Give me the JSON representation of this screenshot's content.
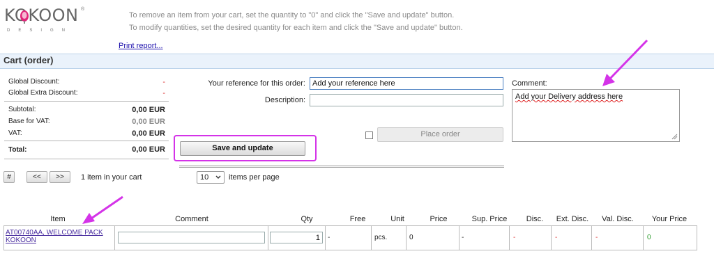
{
  "header": {
    "logo_text": "KOKOON",
    "logo_subtext": "DESIGN",
    "logo_mark": "®",
    "instructions": [
      "To remove an item from your cart, set the quantity to \"0\" and click the \"Save and update\" button.",
      "To modify quantities, set the desired quantity for each item and click the \"Save and update\" button."
    ],
    "print_report": "Print report..."
  },
  "section": {
    "title": "Cart (order)"
  },
  "totals": {
    "global_discount_label": "Global Discount:",
    "global_discount_value": "-",
    "global_extra_discount_label": "Global Extra Discount:",
    "global_extra_discount_value": "-",
    "subtotal_label": "Subtotal:",
    "subtotal_value": "0,00 EUR",
    "base_vat_label": "Base for VAT:",
    "base_vat_value": "0,00 EUR",
    "vat_label": "VAT:",
    "vat_value": "0,00 EUR",
    "total_label": "Total:",
    "total_value": "0,00 EUR"
  },
  "form": {
    "reference_label": "Your reference for this order:",
    "reference_value": "Add your reference here",
    "description_label": "Description:",
    "description_value": "",
    "place_order_label": "Place order",
    "save_update_label": "Save and update",
    "comment_label": "Comment:",
    "comment_value": "Add your Delivery address here"
  },
  "pager": {
    "hash_label": "#",
    "prev_label": "<<",
    "next_label": ">>",
    "items_text": "1 item in your cart",
    "per_page_value": "10",
    "per_page_label": "items per page"
  },
  "table": {
    "headers": [
      "Item",
      "Comment",
      "Qty",
      "Free",
      "Unit",
      "Price",
      "Sup. Price",
      "Disc.",
      "Ext. Disc.",
      "Val. Disc.",
      "Your Price"
    ],
    "row": {
      "item_line1": "AT00740AA, WELCOME PACK",
      "item_line2": "KOKOON",
      "comment": "",
      "qty": "1",
      "free": "-",
      "unit": "pcs.",
      "price": "0",
      "sup_price": "-",
      "disc": "-",
      "ext_disc": "-",
      "val_disc": "-",
      "your_price": "0"
    }
  },
  "colors": {
    "accent_highlight": "#d433e8",
    "section_bar": "#eaf2fb",
    "link": "#4a2ea0",
    "negative": "#dd3333",
    "positive": "#2a9a2a"
  },
  "icons": {
    "logo": "kokoon-logo",
    "dropdown": "chevron-down-icon",
    "resize": "resize-grip-icon",
    "annotation": "annotation-arrow-icon"
  }
}
